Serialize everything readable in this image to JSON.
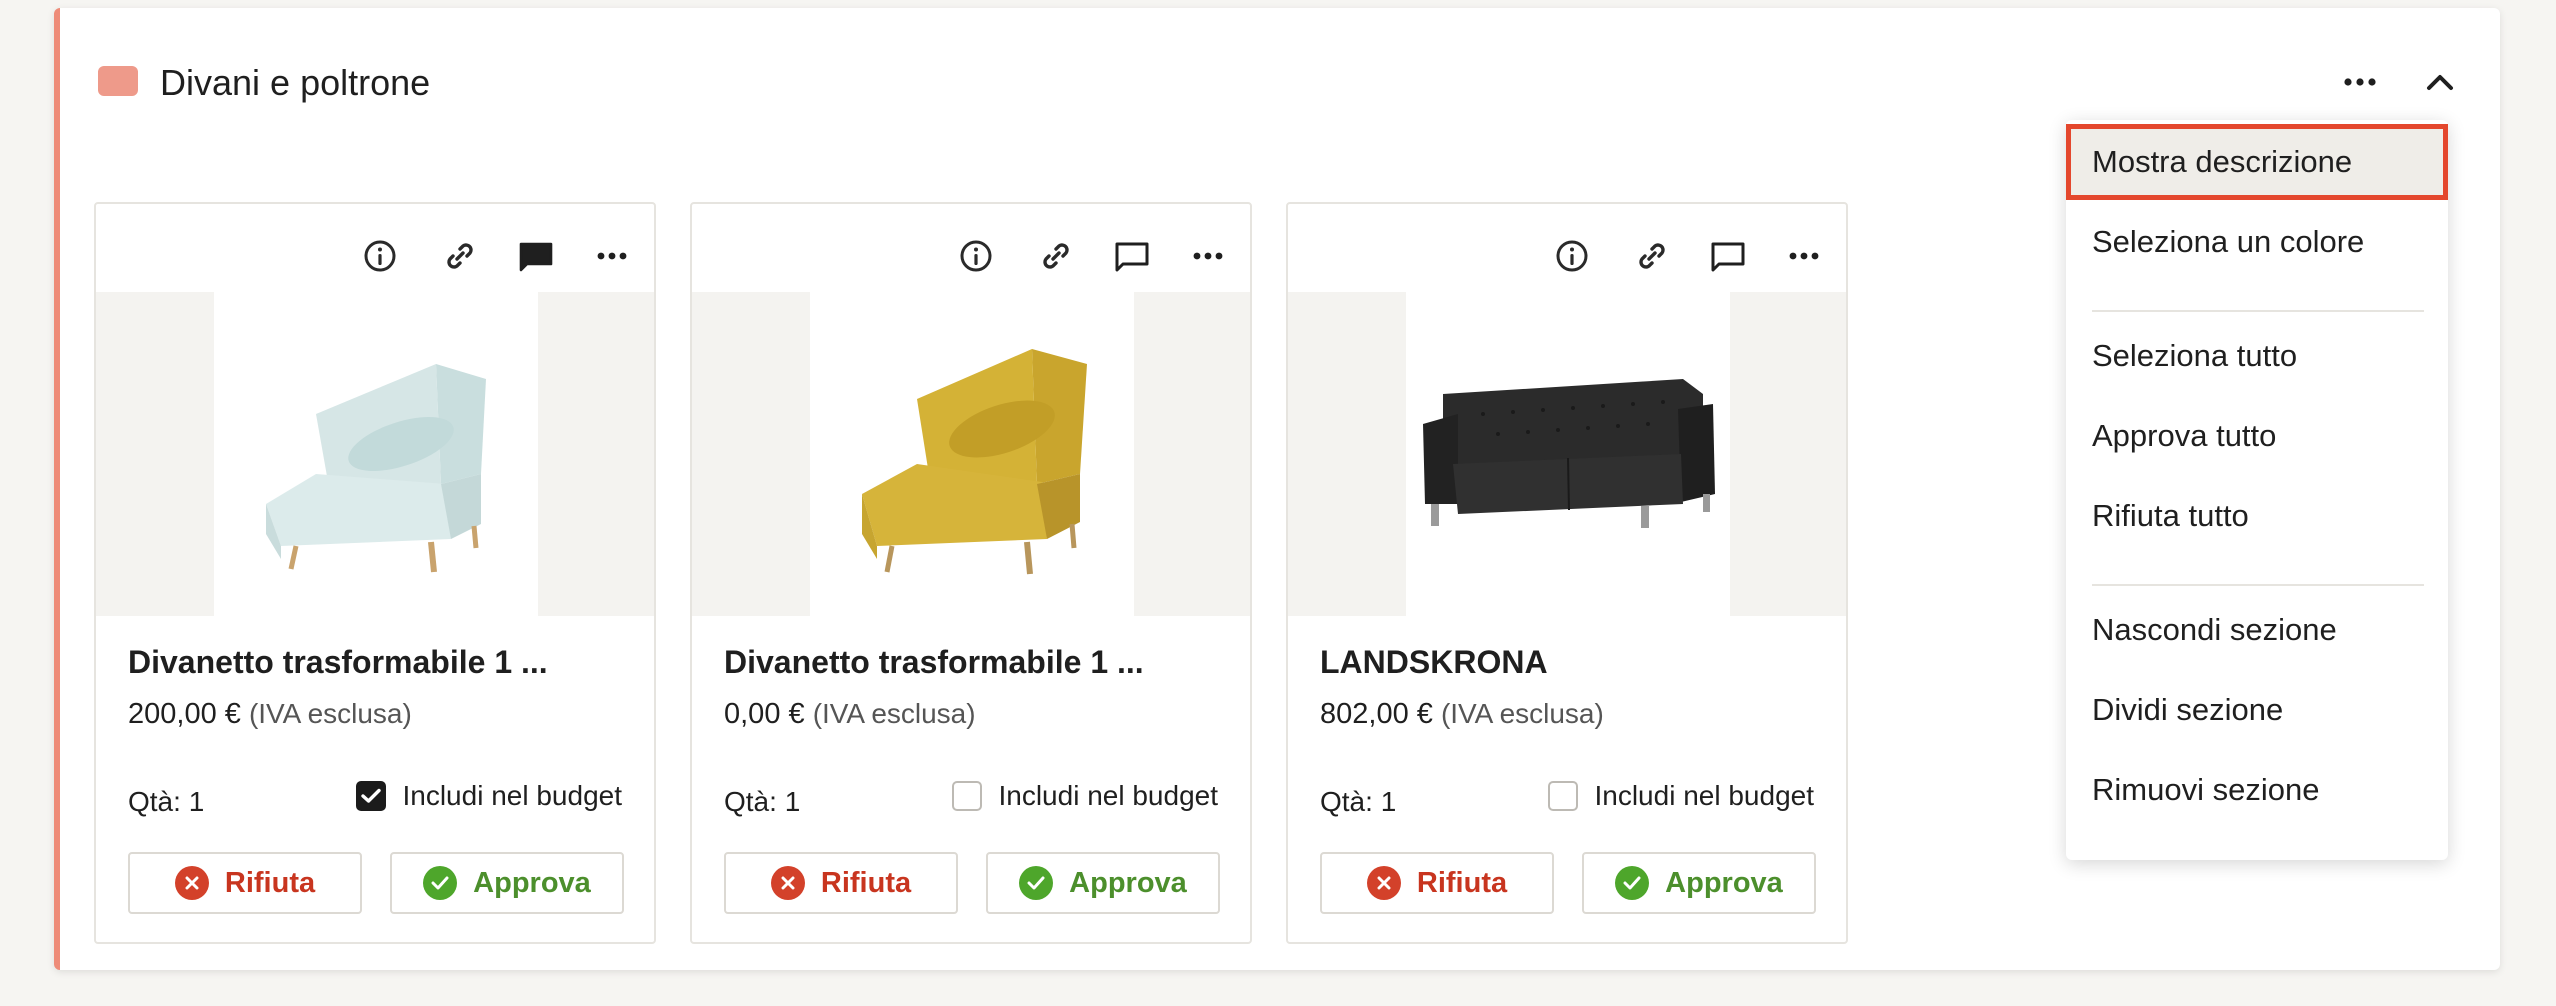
{
  "section": {
    "title": "Divani e poltrone",
    "color": "#ee9a8a"
  },
  "header_icons": {
    "more": "more-horizontal-icon",
    "collapse": "chevron-up-icon"
  },
  "card_icons": [
    "info-icon",
    "link-icon",
    "comment-icon",
    "more-horizontal-icon"
  ],
  "cards": [
    {
      "name": "Divanetto trasformabile 1 ...",
      "price": "200,00 €",
      "vat": "(IVA esclusa)",
      "qty": "Qtà: 1",
      "budget_label": "Includi nel budget",
      "budget_checked": true,
      "reject_label": "Rifiuta",
      "approve_label": "Approva"
    },
    {
      "name": "Divanetto trasformabile 1 ...",
      "price": "0,00 €",
      "vat": "(IVA esclusa)",
      "qty": "Qtà: 1",
      "budget_label": "Includi nel budget",
      "budget_checked": false,
      "reject_label": "Rifiuta",
      "approve_label": "Approva"
    },
    {
      "name": "LANDSKRONA",
      "price": "802,00 €",
      "vat": "(IVA esclusa)",
      "qty": "Qtà: 1",
      "budget_label": "Includi nel budget",
      "budget_checked": false,
      "reject_label": "Rifiuta",
      "approve_label": "Approva"
    }
  ],
  "menu": {
    "items": [
      "Mostra descrizione",
      "Seleziona un colore",
      "Seleziona tutto",
      "Approva tutto",
      "Rifiuta tutto",
      "Nascondi sezione",
      "Dividi sezione",
      "Rimuovi sezione"
    ],
    "highlighted": "Mostra descrizione"
  },
  "colors": {
    "accent": "#ee8b78",
    "reject": "#c8351f",
    "approve": "#4c8f2c",
    "highlight_border": "#e4472d"
  }
}
